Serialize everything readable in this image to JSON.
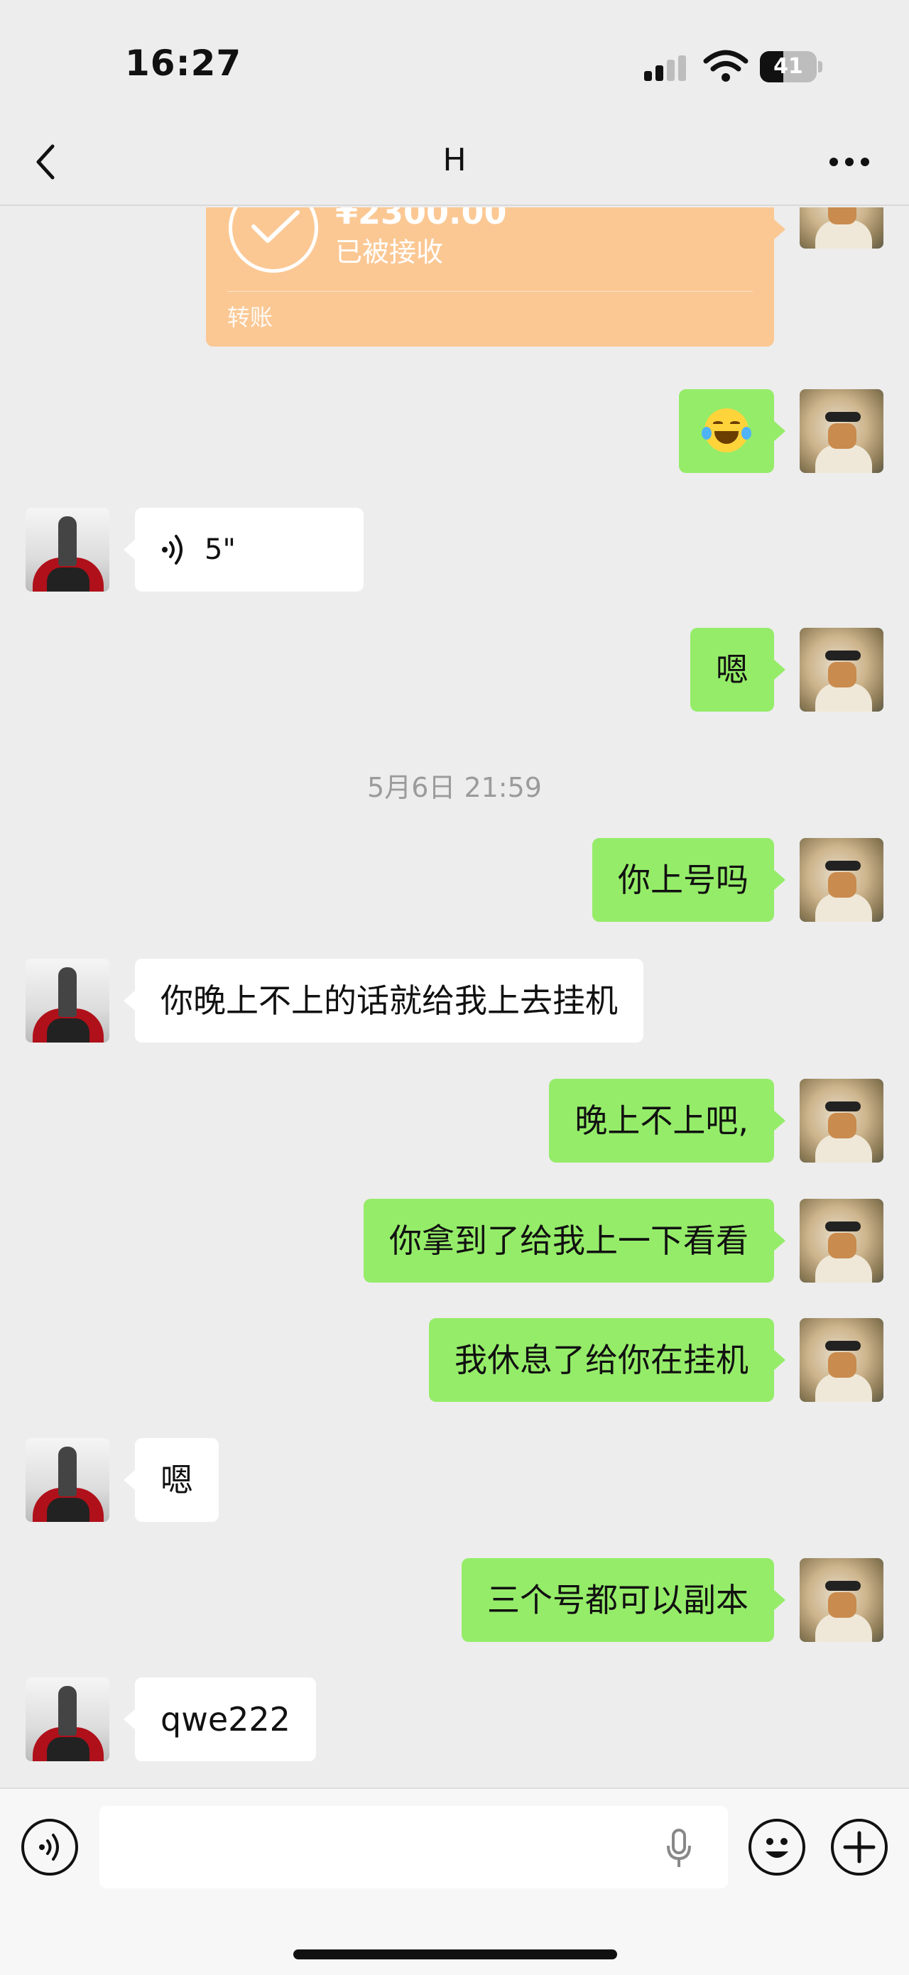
{
  "status_bar": {
    "time": "16:27",
    "battery": "41",
    "battery_level": 0.41
  },
  "nav": {
    "title": "H"
  },
  "transfer": {
    "amount": "¥2300.00",
    "status": "已被接收",
    "type": "转账"
  },
  "messages": {
    "emoji": "😂",
    "voice_duration": "5\"",
    "m_en": "嗯",
    "timestamp": "5月6日 21:59",
    "m1": "你上号吗",
    "m2": "你晚上不上的话就给我上去挂机",
    "m3": "晚上不上吧,",
    "m4": "你拿到了给我上一下看看",
    "m5": "我休息了给你在挂机",
    "m6": "嗯",
    "m7": "三个号都可以副本",
    "m8": "qwe222"
  },
  "input": {
    "placeholder": ""
  },
  "colors": {
    "bubble_me": "#95ec69",
    "bubble_other": "#ffffff",
    "transfer": "#fbc894",
    "background": "#ededed"
  }
}
